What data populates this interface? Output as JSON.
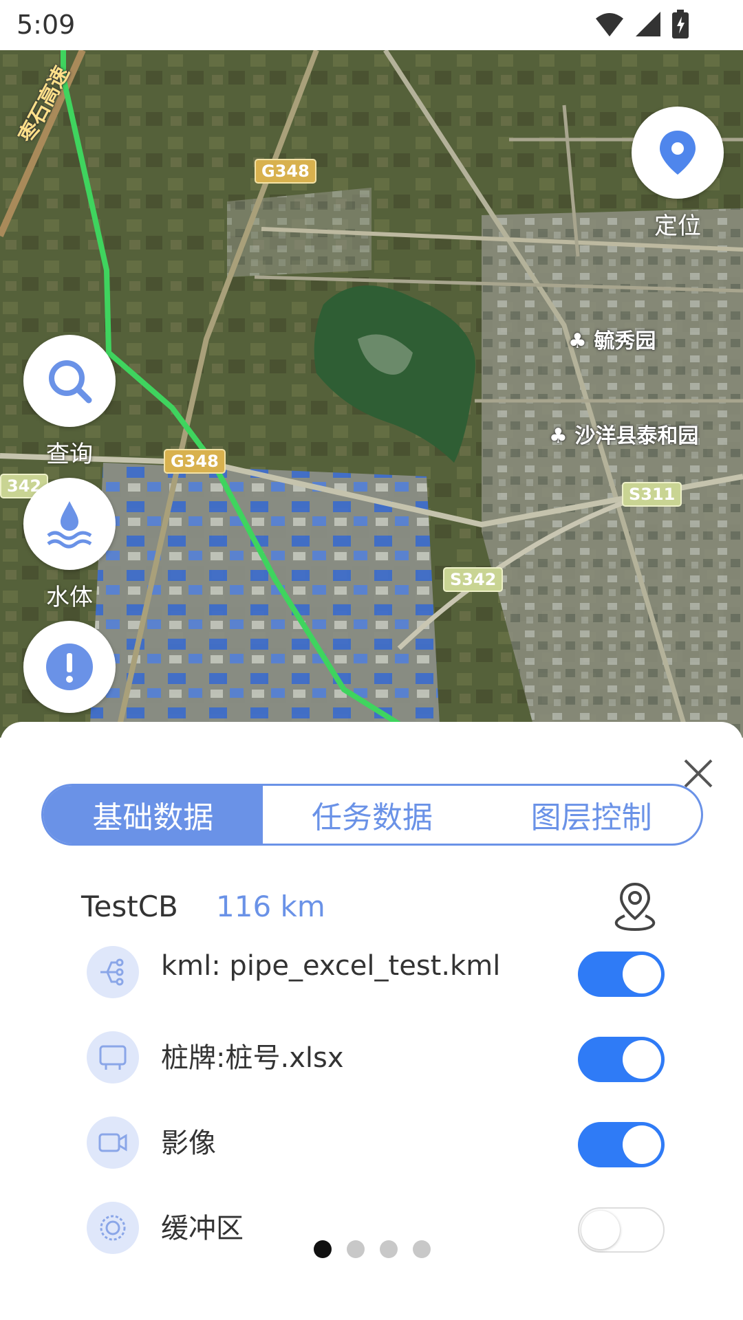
{
  "status_bar": {
    "time": "5:09"
  },
  "map": {
    "labels": {
      "park1": "毓秀园",
      "park2": "沙洋县泰和园",
      "highway_vertical": "枣石高速",
      "shield_g348_top": "G348",
      "shield_g348_mid": "G348",
      "shield_342_left": "342",
      "shield_s311": "S311",
      "shield_s342": "S342"
    }
  },
  "buttons": {
    "locate_label": "定位",
    "search_label": "查询",
    "water_label": "水体",
    "alert_label": ""
  },
  "sheet": {
    "tabs": [
      {
        "label": "基础数据",
        "active": true
      },
      {
        "label": "任务数据",
        "active": false
      },
      {
        "label": "图层控制",
        "active": false
      }
    ],
    "route": {
      "name": "TestCB",
      "distance": "116 km"
    },
    "layers": [
      {
        "label": "kml: pipe_excel_test.kml",
        "icon": "pipeline-icon",
        "enabled": true
      },
      {
        "label": "桩牌:桩号.xlsx",
        "icon": "signboard-icon",
        "enabled": true
      },
      {
        "label": "影像",
        "icon": "video-camera-icon",
        "enabled": true
      },
      {
        "label": "缓冲区",
        "icon": "buffer-zone-icon",
        "enabled": false
      }
    ],
    "page_indicator": {
      "pages": 4,
      "current": 1
    }
  },
  "colors": {
    "accent": "#6a92e7",
    "toggle_on": "#2f7bf6",
    "route_line": "#3fd45e"
  }
}
